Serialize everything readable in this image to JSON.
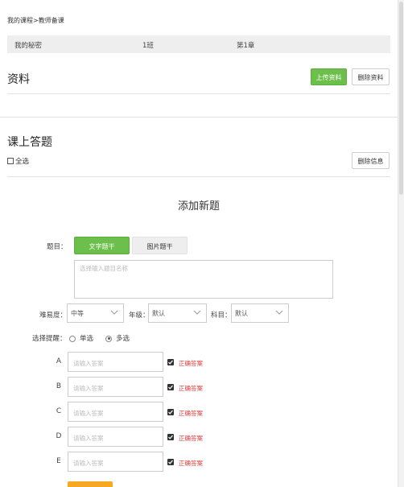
{
  "breadcrumb": "我的课程>教师备课",
  "infobar": {
    "course": "我的秘密",
    "class": "1班",
    "chapter": "第1章"
  },
  "materials": {
    "title": "资料",
    "upload_label": "上传资料",
    "delete_label": "删除资料"
  },
  "questions": {
    "title": "课上答题",
    "select_all": "全选",
    "delete_label": "删除信息"
  },
  "form": {
    "title": "添加新题",
    "topic_label": "题目：",
    "tab_text": "文字题干",
    "tab_image": "图片题干",
    "topic_placeholder": "选择输入题目名称",
    "difficulty_label": "难易度：",
    "difficulty_value": "中等",
    "grade_label": "年级：",
    "grade_value": "默认",
    "subject_label": "科目：",
    "subject_value": "默认",
    "type_label": "选择提醒：",
    "type_single": "单选",
    "type_multi": "多选",
    "options": [
      {
        "letter": "A",
        "placeholder": "请输入答案",
        "correct_label": "正确答案"
      },
      {
        "letter": "B",
        "placeholder": "请输入答案",
        "correct_label": "正确答案"
      },
      {
        "letter": "C",
        "placeholder": "请输入答案",
        "correct_label": "正确答案"
      },
      {
        "letter": "D",
        "placeholder": "请输入答案",
        "correct_label": "正确答案"
      },
      {
        "letter": "E",
        "placeholder": "请输入答案",
        "correct_label": "正确答案"
      }
    ]
  },
  "colors": {
    "accent_green": "#6cbf4b",
    "correct_red": "#e03a3a",
    "submit_orange": "#f7a823"
  },
  "icons": [
    "chevron-down-icon",
    "checkbox-icon",
    "radio-icon"
  ]
}
